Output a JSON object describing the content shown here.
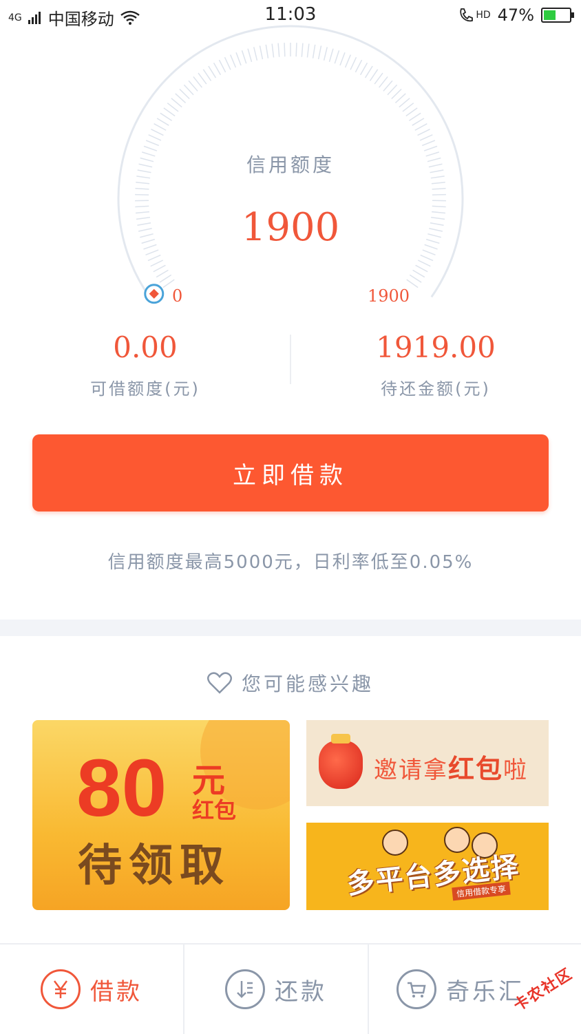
{
  "status_bar": {
    "network": "4G",
    "carrier": "中国移动",
    "time": "11:03",
    "hd_label": "HD",
    "battery": "47%",
    "battery_level": 0.47
  },
  "credit": {
    "label": "信用额度",
    "value": "1900",
    "min": "0",
    "max": "1900"
  },
  "stats": {
    "available": {
      "value": "0.00",
      "label": "可借额度(元)"
    },
    "due": {
      "value": "1919.00",
      "label": "待还金额(元)"
    }
  },
  "actions": {
    "borrow_now": "立即借款"
  },
  "notice": "信用额度最高5000元，日利率低至0.05%",
  "interests": {
    "title": "您可能感兴趣",
    "big_banner": {
      "amount": "80",
      "unit": "元",
      "sub": "红包",
      "claim": "待领取"
    },
    "invite_banner": {
      "pre": "邀请拿",
      "highlight": "红包",
      "post": "啦"
    },
    "platform_banner": {
      "text": "多平台多选择",
      "tag": "信用借款专享"
    }
  },
  "tabs": [
    {
      "label": "借款",
      "icon": "yuan-icon",
      "active": true
    },
    {
      "label": "还款",
      "icon": "repay-icon",
      "active": false
    },
    {
      "label": "奇乐汇",
      "icon": "cart-icon",
      "active": false
    }
  ],
  "watermark": "卡农社区",
  "colors": {
    "accent": "#f0573a",
    "button": "#fd5831",
    "muted": "#8a96a8",
    "banner_yellow": "#f7b51c"
  }
}
